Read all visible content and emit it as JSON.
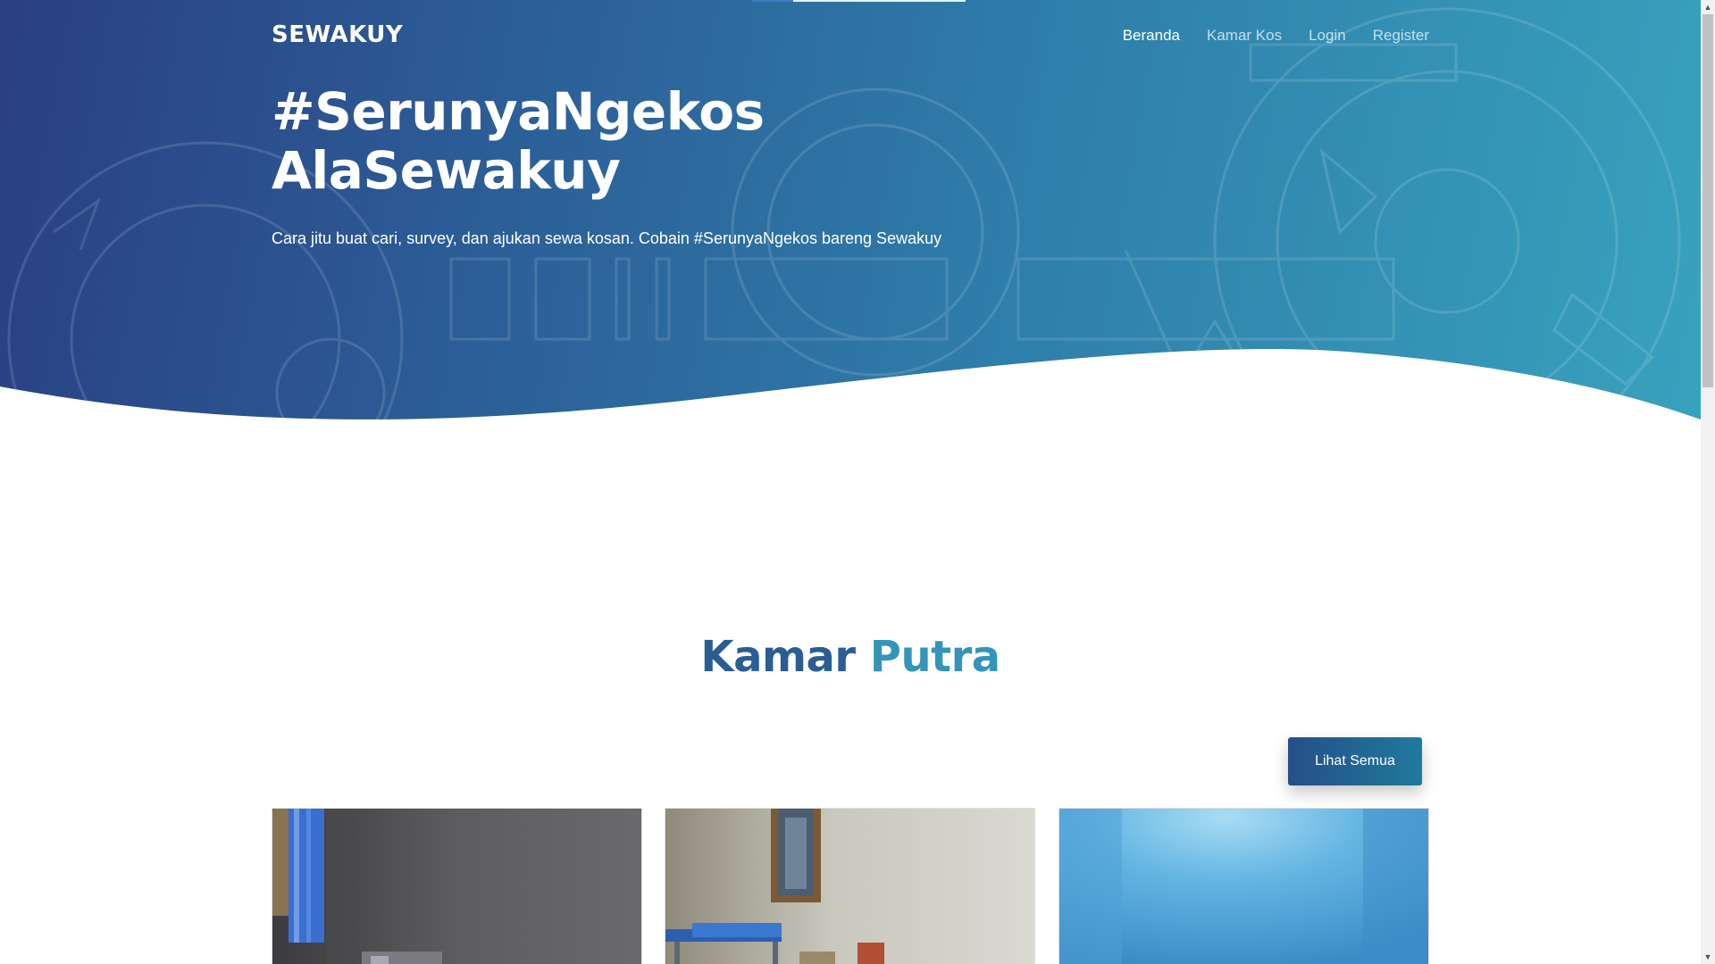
{
  "navbar": {
    "brand": "SEWAKUY",
    "links": [
      {
        "label": "Beranda",
        "active": true
      },
      {
        "label": "Kamar Kos",
        "active": false
      },
      {
        "label": "Login",
        "active": false
      },
      {
        "label": "Register",
        "active": false
      }
    ]
  },
  "hero": {
    "title_line1": "#SerunyaNgekos",
    "title_line2": "AlaSewakuy",
    "subtitle": "Cara jitu buat cari, survey, dan ajukan sewa kosan. Cobain #SerunyaNgekos bareng Sewakuy"
  },
  "section": {
    "title_word1": "Kamar",
    "title_word2": "Putra",
    "view_all_label": "Lihat Semua"
  },
  "colors": {
    "hero_gradient_start": "#2a3f82",
    "hero_gradient_end": "#38a2bd",
    "title_dark": "#2a5d93",
    "title_light": "#3594b9",
    "button_start": "#254f88",
    "button_end": "#1f7a9e"
  },
  "icons": {
    "scroll_up": "▲",
    "scroll_down": "▼"
  }
}
